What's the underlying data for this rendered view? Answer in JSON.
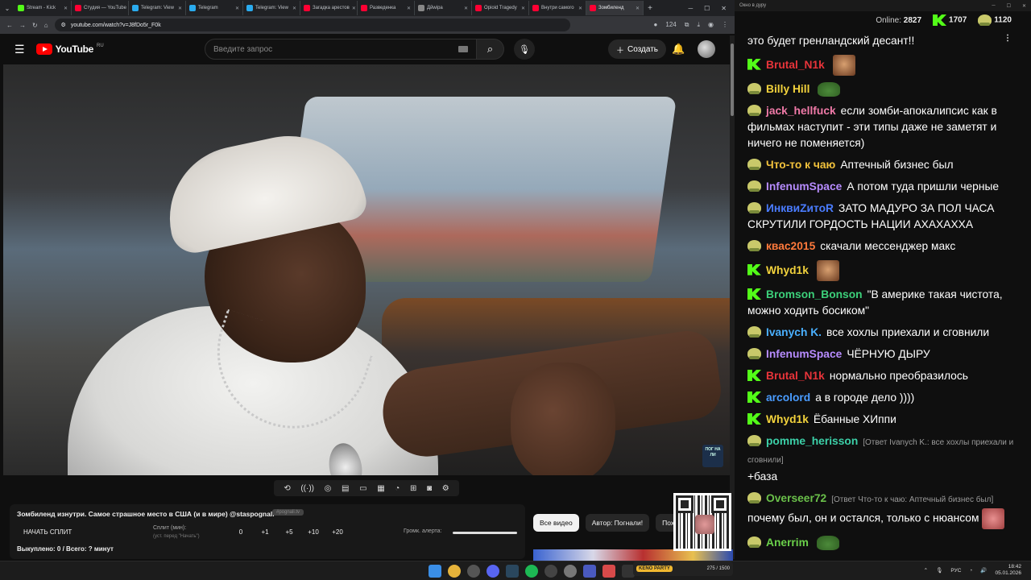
{
  "browser": {
    "tabs": [
      {
        "title": "Stream - Kick",
        "color": "#53fc18"
      },
      {
        "title": "Студия — YouTube",
        "color": "#ff0033"
      },
      {
        "title": "Telegram: View",
        "color": "#2aabee"
      },
      {
        "title": "Telegram",
        "color": "#2aabee"
      },
      {
        "title": "Telegram: View",
        "color": "#2aabee"
      },
      {
        "title": "Загадка арестов",
        "color": "#ff0033"
      },
      {
        "title": "Разведенка",
        "color": "#ff0033"
      },
      {
        "title": "Дйwipa",
        "color": "#888888"
      },
      {
        "title": "Opioid Tragedy",
        "color": "#ff0033"
      },
      {
        "title": "Внутри самого",
        "color": "#ff0033"
      },
      {
        "title": "Зомбиленд",
        "color": "#ff0033"
      }
    ],
    "url": "youtube.com/watch?v=J8fDo5r_F0k",
    "badge_count": "124"
  },
  "youtube": {
    "logo_text": "YouTube",
    "region": "RU",
    "search_placeholder": "Введите запрос",
    "create_label": "Создать",
    "watermark": "ПОГ НА ЛИ"
  },
  "ext_bar": [
    "loop",
    "cast",
    "camera-eye",
    "clapper",
    "frame",
    "grid",
    "gauge",
    "plus",
    "screenshot",
    "settings"
  ],
  "info_panel": {
    "video_title": "Зомбиленд изнутри. Самое страшное место в США (и в мире) @stаspognali",
    "tag": "#pognali.tv",
    "split_button": "НАЧАТЬ СПЛИТ",
    "split_label": "Сплит (мин):",
    "split_sub": "(уст. перед \"Начать\")",
    "split_values": [
      "0",
      "+1",
      "+5",
      "+10",
      "+20"
    ],
    "alert_label": "Громк. алерта:",
    "paid_line": "Выкуплено: 0 / Всего: ? минут"
  },
  "chips": [
    "Все видео",
    "Автор: Погнали!",
    "Похо"
  ],
  "chat": {
    "window_title": "Окно в дуру",
    "online_label": "Online:",
    "online_count": "2827",
    "kick_count": "1707",
    "pepe_count": "1120",
    "messages": [
      {
        "badge": "",
        "user": "",
        "color": "#ffffff",
        "text": "это будет гренландский десант!!",
        "emote": ""
      },
      {
        "badge": "k",
        "user": "Brutal_N1k",
        "color": "#e8343a",
        "text": "",
        "emote": "face"
      },
      {
        "badge": "p",
        "user": "Billy Hill",
        "color": "#f2d23c",
        "text": "",
        "emote": "frog"
      },
      {
        "badge": "p",
        "user": "jack_hellfuck",
        "color": "#f07aa8",
        "text": "если зомби-апокалипсис как в фильмах наступит - эти типы даже не заметят и ничего не поменяется)",
        "emote": ""
      },
      {
        "badge": "p",
        "user": "Что-то к чаю",
        "color": "#f2c23c",
        "text": "Аптечный бизнес был",
        "emote": ""
      },
      {
        "badge": "p",
        "user": "InfenumSpace",
        "color": "#b78cff",
        "text": "А потом туда пришли черные",
        "emote": ""
      },
      {
        "badge": "p",
        "user": "ИнквиZитоR",
        "color": "#4a7cff",
        "text": "ЗАТО МАДУРО ЗА ПОЛ ЧАСА СКРУТИЛИ ГОРДОСТЬ НАЦИИ АХАХАХХА",
        "emote": ""
      },
      {
        "badge": "p",
        "user": "квас2015",
        "color": "#ff7a3c",
        "text": "скачали мессенджер макс",
        "emote": ""
      },
      {
        "badge": "k",
        "user": "Whyd1k",
        "color": "#f2d23c",
        "text": "",
        "emote": "face"
      },
      {
        "badge": "k",
        "user": "Bromson_Bonson",
        "color": "#3cd07a",
        "text": "\"В америке такая чистота, можно ходить босиком\"",
        "emote": ""
      },
      {
        "badge": "p",
        "user": "Ivanych K.",
        "color": "#4ab0ff",
        "text": "все хохлы приехали и сговнили",
        "emote": ""
      },
      {
        "badge": "p",
        "user": "InfenumSpace",
        "color": "#b78cff",
        "text": "ЧЁРНУЮ ДЫРУ",
        "emote": ""
      },
      {
        "badge": "k",
        "user": "Brutal_N1k",
        "color": "#e8343a",
        "text": "нормально преобразилось",
        "emote": ""
      },
      {
        "badge": "k",
        "user": "arcolord",
        "color": "#4a9cff",
        "text": "а в городе дело ))))",
        "emote": ""
      },
      {
        "badge": "k",
        "user": "Whyd1k",
        "color": "#f2d23c",
        "text": "Ёбанные ХИппи",
        "emote": ""
      },
      {
        "badge": "p",
        "user": "pomme_herisson",
        "color": "#3cd0a8",
        "reply": "[Ответ Ivanych K.: все хохлы приехали и сговнили]",
        "text": "+база",
        "emote": ""
      },
      {
        "badge": "p",
        "user": "Overseer72",
        "color": "#6ac04a",
        "reply": "[Ответ Что-то к чаю: Аптечный бизнес был]",
        "text": "почему был, он и остался, только с нюансом",
        "emote": "cry"
      },
      {
        "badge": "p",
        "user": "Anerrim",
        "color": "#6ad04a",
        "text": "",
        "emote": "frog"
      }
    ]
  },
  "taskbar": {
    "keno_label": "KENO PARTY",
    "keno_count": "275 / 1500",
    "lang": "РУС",
    "time": "18:42",
    "date": "05.01.2026"
  }
}
